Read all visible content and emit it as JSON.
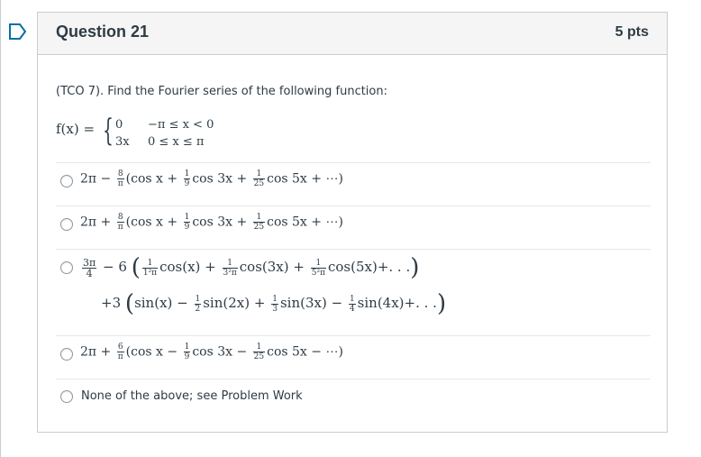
{
  "question": {
    "title": "Question 21",
    "points": "5 pts",
    "prompt": "(TCO 7). Find the Fourier series of the following function:",
    "function": {
      "lhs": "f(x) =",
      "cases": [
        {
          "value": "0",
          "condition": "−π ≤ x < 0"
        },
        {
          "value": "3x",
          "condition": "0 ≤ x ≤ π"
        }
      ]
    }
  },
  "answers": [
    {
      "id": "a",
      "lead": "2π −",
      "coef_num": "8",
      "coef_den": "π",
      "open": "(cos x +",
      "f1_num": "1",
      "f1_den": "9",
      "mid": "cos 3x +",
      "f2_num": "1",
      "f2_den": "25",
      "tail": "cos 5x + ⋯)"
    },
    {
      "id": "b",
      "lead": "2π +",
      "coef_num": "8",
      "coef_den": "π",
      "open": "(cos x +",
      "f1_num": "1",
      "f1_den": "9",
      "mid": "cos 3x +",
      "f2_num": "1",
      "f2_den": "25",
      "tail": "cos 5x + ⋯)"
    },
    {
      "id": "c",
      "line1": {
        "a_num": "3π",
        "a_den": "4",
        "minus6": "− 6",
        "t1_num": "1",
        "t1_den": "1²π",
        "t1": "cos(x) +",
        "t2_num": "1",
        "t2_den": "3²π",
        "t2": "cos(3x) +",
        "t3_num": "1",
        "t3_den": "5²π",
        "t3": "cos(5x)+. . ."
      },
      "line2": {
        "lead": "+3",
        "s0": "sin(x) −",
        "s1_num": "1",
        "s1_den": "2",
        "s1": "sin(2x) +",
        "s2_num": "1",
        "s2_den": "3",
        "s2": "sin(3x) −",
        "s3_num": "1",
        "s3_den": "4",
        "s3": "sin(4x)+. . ."
      }
    },
    {
      "id": "d",
      "lead": "2π +",
      "coef_num": "6",
      "coef_den": "π",
      "open": "(cos x −",
      "f1_num": "1",
      "f1_den": "9",
      "mid": "cos 3x −",
      "f2_num": "1",
      "f2_den": "25",
      "tail": "cos 5x − ⋯)"
    },
    {
      "id": "e",
      "text": "None of the above; see Problem Work"
    }
  ],
  "colors": {
    "accent": "#0770a3",
    "border": "#c7cdd1",
    "header_bg": "#f5f5f5",
    "text": "#2d3b45"
  },
  "icons": {
    "bookmark": "bookmark-outline-icon"
  }
}
